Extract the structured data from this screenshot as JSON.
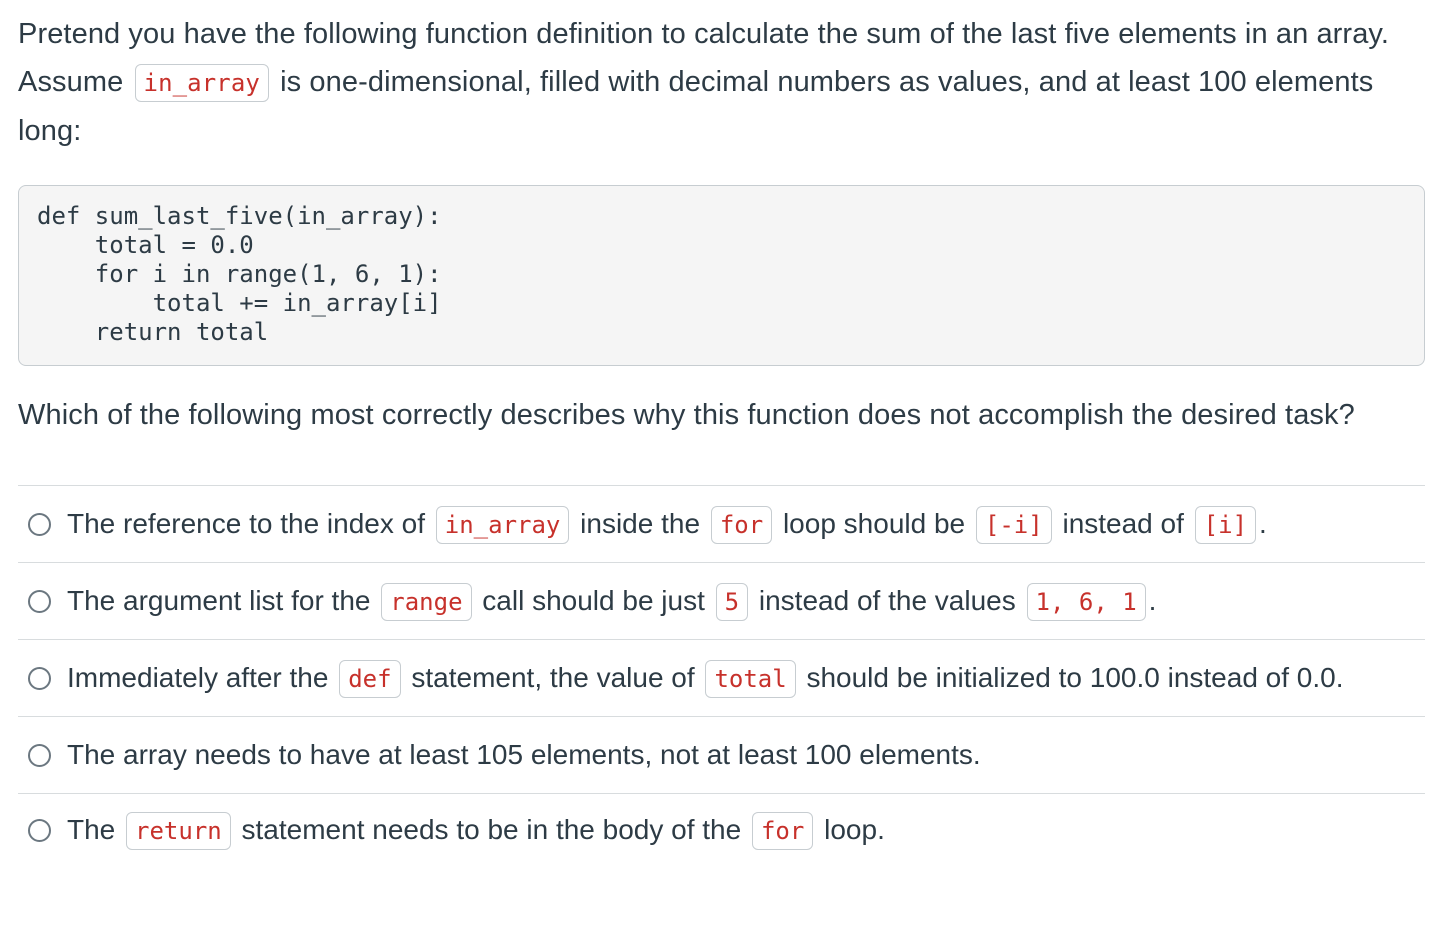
{
  "intro": {
    "part1": "Pretend you have the following function definition to calculate the sum of the last five elements in an array. Assume",
    "code": "in_array",
    "part2": "is one-dimensional, filled with decimal numbers as values, and at least 100 elements long:"
  },
  "code_block": {
    "lines": [
      "def sum_last_five(in_array):",
      "    total = 0.0",
      "    for i in range(1, 6, 1):",
      "        total += in_array[i]",
      "    return total"
    ]
  },
  "question": "Which of the following most correctly describes why this function does not accomplish the desired task?",
  "answers": [
    {
      "segments": [
        {
          "t": "The reference to the index of"
        },
        {
          "code": "in_array"
        },
        {
          "t": "inside the"
        },
        {
          "code": "for"
        },
        {
          "t": "loop should be"
        },
        {
          "code": "[-i]"
        },
        {
          "t": "instead of"
        },
        {
          "code": "[i]"
        },
        {
          "t": "."
        }
      ]
    },
    {
      "segments": [
        {
          "t": "The argument list for the"
        },
        {
          "code": "range"
        },
        {
          "t": "call should be just"
        },
        {
          "code": "5"
        },
        {
          "t": "instead of the values"
        },
        {
          "code": "1, 6, 1"
        },
        {
          "t": "."
        }
      ]
    },
    {
      "segments": [
        {
          "t": "Immediately after the"
        },
        {
          "code": "def"
        },
        {
          "t": "statement, the value of"
        },
        {
          "code": "total"
        },
        {
          "t": "should be initialized to 100.0 instead of 0.0."
        }
      ]
    },
    {
      "segments": [
        {
          "t": "The array needs to have at least 105 elements, not at least 100 elements."
        }
      ]
    },
    {
      "segments": [
        {
          "t": "The"
        },
        {
          "code": "return"
        },
        {
          "t": "statement needs to be in the body of the"
        },
        {
          "code": "for"
        },
        {
          "t": "loop."
        }
      ]
    }
  ],
  "colors": {
    "text": "#2d3b45",
    "code_inline": "#c7312b",
    "code_bg": "#f5f5f5",
    "border": "#c7cdd1"
  }
}
